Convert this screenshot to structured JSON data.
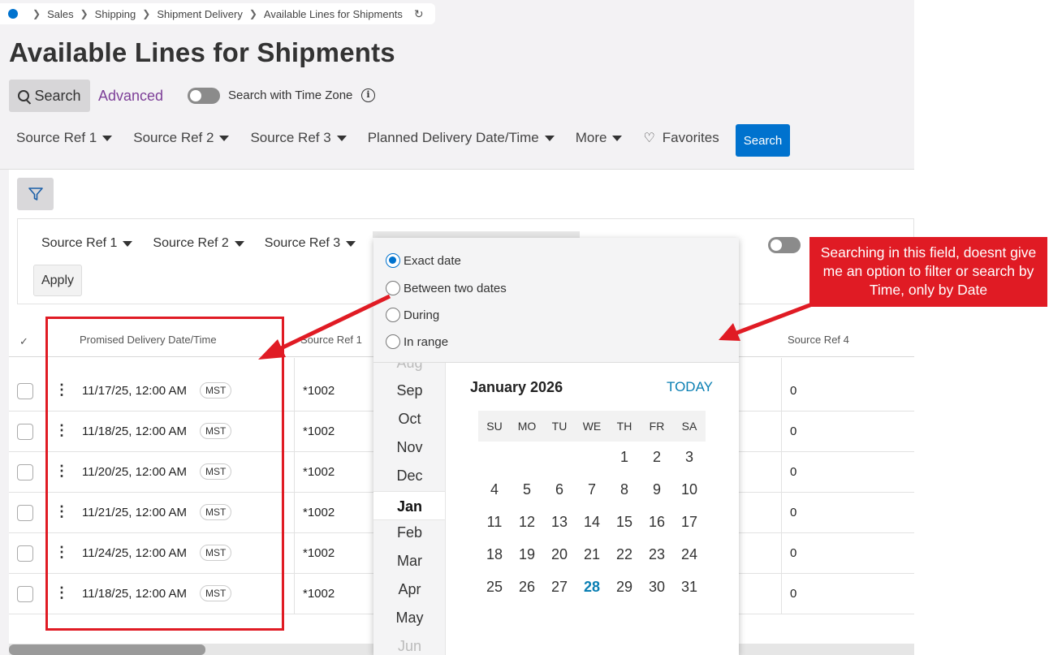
{
  "breadcrumb": {
    "items": [
      "Sales",
      "Shipping",
      "Shipment Delivery",
      "Available Lines for Shipments"
    ],
    "refresh_icon": "refresh-icon"
  },
  "page_title": "Available Lines for Shipments",
  "search_bar": {
    "search_mode_label": "Search",
    "advanced_label": "Advanced",
    "timezone_label": "Search with Time Zone",
    "timezone_enabled": false
  },
  "filters": {
    "items": [
      "Source Ref 1",
      "Source Ref 2",
      "Source Ref 3",
      "Planned Delivery Date/Time",
      "More"
    ],
    "favorites_label": "Favorites",
    "search_button": "Search"
  },
  "advanced_panel": {
    "filters": [
      "Source Ref 1",
      "Source Ref 2",
      "Source Ref 3"
    ],
    "apply_label": "Apply"
  },
  "table": {
    "columns": [
      "Promised Delivery Date/Time",
      "Source Ref 1",
      "Source Ref 4"
    ],
    "rows": [
      {
        "date": "11/17/25, 12:00 AM",
        "tz": "MST",
        "ref1": "*1002",
        "ref4": "0"
      },
      {
        "date": "11/18/25, 12:00 AM",
        "tz": "MST",
        "ref1": "*1002",
        "ref4": "0"
      },
      {
        "date": "11/20/25, 12:00 AM",
        "tz": "MST",
        "ref1": "*1002",
        "ref4": "0"
      },
      {
        "date": "11/21/25, 12:00 AM",
        "tz": "MST",
        "ref1": "*1002",
        "ref4": "0"
      },
      {
        "date": "11/24/25, 12:00 AM",
        "tz": "MST",
        "ref1": "*1002",
        "ref4": "0"
      },
      {
        "date": "11/18/25, 12:00 AM",
        "tz": "MST",
        "ref1": "*1002",
        "ref4": "0"
      }
    ]
  },
  "date_picker": {
    "options": [
      "Exact date",
      "Between two dates",
      "During",
      "In range"
    ],
    "selected_option": "Exact date",
    "months": [
      "Aug",
      "Sep",
      "Oct",
      "Nov",
      "Dec",
      "Jan",
      "Feb",
      "Mar",
      "Apr",
      "May",
      "Jun"
    ],
    "selected_month": "Jan",
    "calendar_title": "January 2026",
    "today_label": "TODAY",
    "weekdays": [
      "SU",
      "MO",
      "TU",
      "WE",
      "TH",
      "FR",
      "SA"
    ],
    "first_weekday_index": 4,
    "days_in_month": 31,
    "today": 28
  },
  "annotation": {
    "callout_text": "Searching in this field, doesnt give me an option to filter or search by Time, only by Date",
    "accent_color": "#e01b24"
  },
  "colors": {
    "primary": "#0072ce",
    "advanced_link": "#7d3f98",
    "today_link": "#0a7fb3"
  }
}
